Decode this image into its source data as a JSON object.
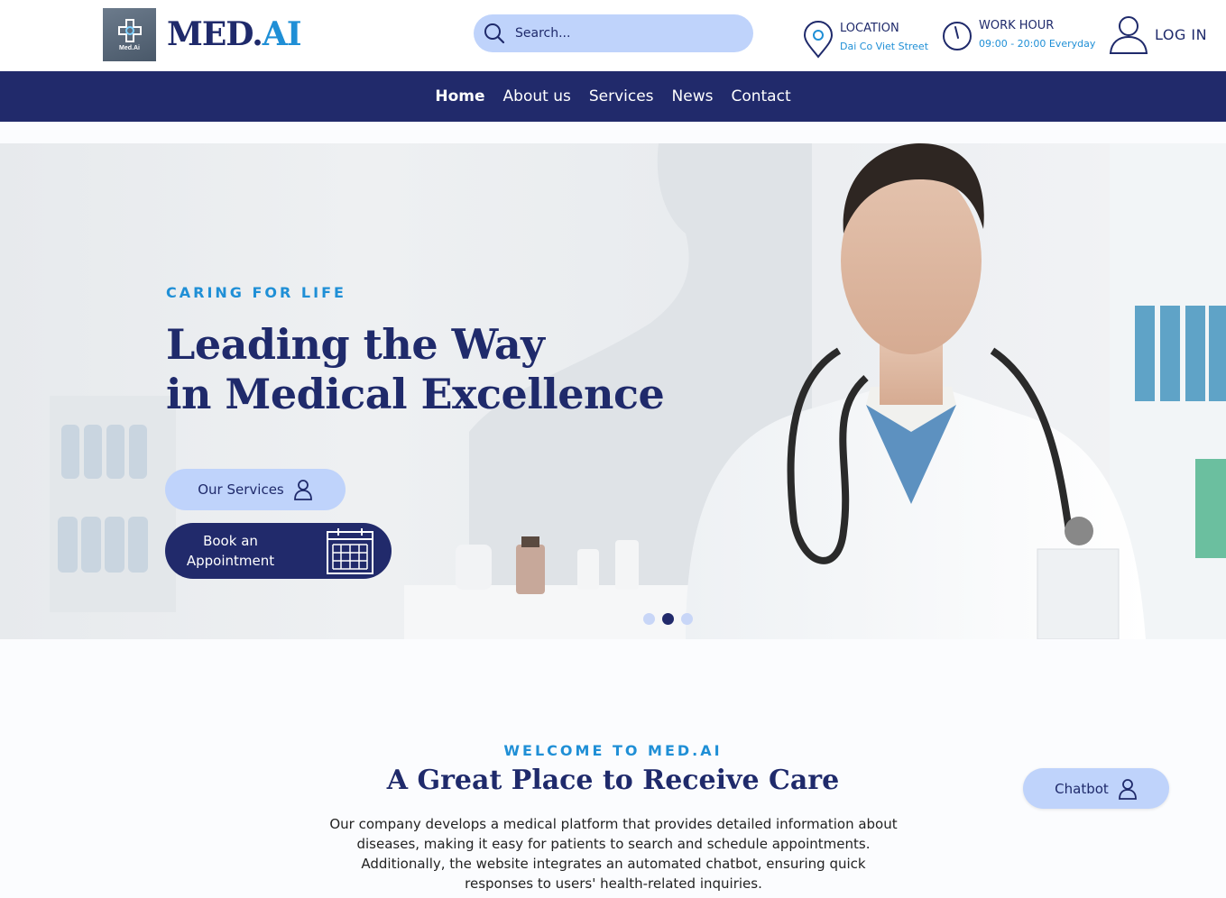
{
  "header": {
    "logo_small": "Med.Ai",
    "brand_part1": "MED.",
    "brand_part2": "AI",
    "search_placeholder": "Search...",
    "location_label": "LOCATION",
    "location_value": "Dai Co Viet Street",
    "work_label": "WORK HOUR",
    "work_value": "09:00 - 20:00 Everyday",
    "login_label": "LOG IN"
  },
  "nav": {
    "items": [
      {
        "label": "Home",
        "active": true
      },
      {
        "label": "About us"
      },
      {
        "label": "Services"
      },
      {
        "label": "News"
      },
      {
        "label": "Contact"
      }
    ]
  },
  "hero": {
    "eyebrow": "CARING FOR LIFE",
    "title_line1": "Leading the Way",
    "title_line2": "in Medical Excellence",
    "services_button": "Our Services",
    "book_line1": "Book an",
    "book_line2": "Appointment",
    "carousel_active_index": 1,
    "carousel_count": 3
  },
  "welcome": {
    "eyebrow": "WELCOME TO MED.AI",
    "title": "A Great Place to Receive Care",
    "line1": "Our company develops a medical platform that provides detailed information about",
    "line2": "diseases, making it easy for patients to search and schedule appointments.",
    "line3": "Additionally, the website integrates an automated chatbot, ensuring quick",
    "line4": "responses to users' health-related inquiries."
  },
  "chatbot": {
    "label": "Chatbot"
  },
  "colors": {
    "navy": "#212a6b",
    "accent": "#1f8fd6",
    "pill": "#bfd3fb"
  }
}
